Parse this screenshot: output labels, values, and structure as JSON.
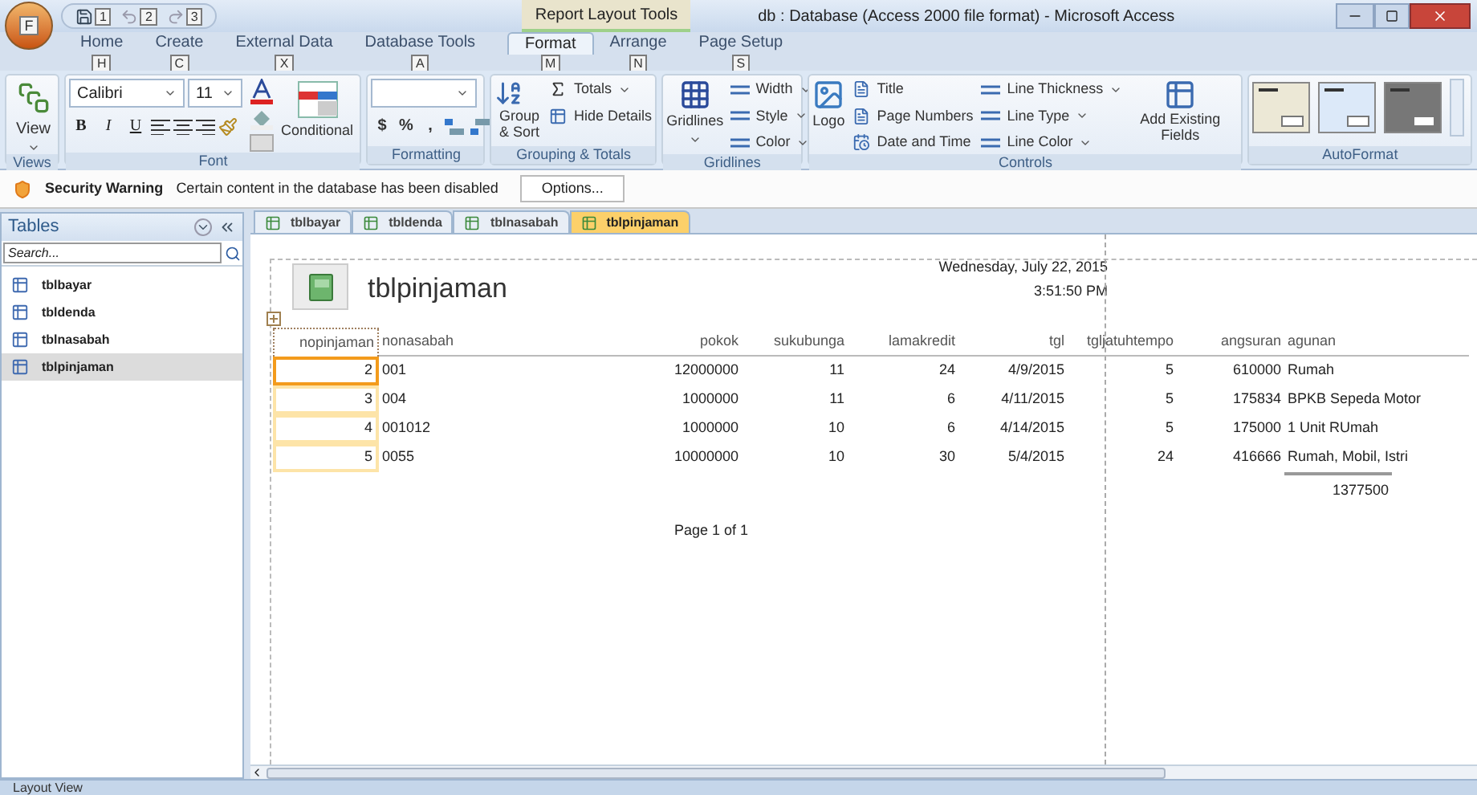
{
  "title_bar": {
    "quick_keytips": [
      "1",
      "2",
      "3"
    ],
    "context_label": "Report Layout Tools",
    "title": "db : Database (Access 2000 file format) - Microsoft Access",
    "office_keytip": "F"
  },
  "ribbon_tabs": [
    {
      "label": "Home",
      "keytip": "H",
      "selected": false
    },
    {
      "label": "Create",
      "keytip": "C",
      "selected": false
    },
    {
      "label": "External Data",
      "keytip": "X",
      "selected": false
    },
    {
      "label": "Database Tools",
      "keytip": "A",
      "selected": false
    },
    {
      "label": "Format",
      "keytip": "M",
      "selected": true
    },
    {
      "label": "Arrange",
      "keytip": "N",
      "selected": false
    },
    {
      "label": "Page Setup",
      "keytip": "S",
      "selected": false
    }
  ],
  "ribbon_groups": [
    {
      "kind": "views",
      "label": "Views",
      "button": "View"
    },
    {
      "kind": "font",
      "label": "Font",
      "font_name": "Calibri",
      "font_size": "11",
      "styles": [
        "B",
        "I",
        "U"
      ],
      "conditional": "Conditional"
    },
    {
      "kind": "formatting",
      "label": "Formatting",
      "symbols": [
        "$",
        "%",
        ","
      ]
    },
    {
      "kind": "grouping",
      "label": "Grouping & Totals",
      "group_sort": "Group & Sort",
      "totals": "Totals",
      "hide_details": "Hide Details"
    },
    {
      "kind": "gridlines",
      "label": "Gridlines",
      "gridlines": "Gridlines",
      "options": [
        "Width",
        "Style",
        "Color"
      ]
    },
    {
      "kind": "controls",
      "label": "Controls",
      "logo": "Logo",
      "inserts": [
        "Title",
        "Page Numbers",
        "Date and Time"
      ],
      "lines": [
        "Line Thickness",
        "Line Type",
        "Line Color"
      ],
      "add_fields": "Add Existing Fields"
    },
    {
      "kind": "autoformat",
      "label": "AutoFormat",
      "swatches": [
        {
          "color": "#ece8d6"
        },
        {
          "color": "#dce9f9"
        },
        {
          "color": "#777777"
        }
      ]
    }
  ],
  "security_bar": {
    "label": "Security Warning",
    "message": "Certain content in the database has been disabled",
    "button": "Options..."
  },
  "navigation_pane": {
    "header": "Tables",
    "search": {
      "placeholder": "Search..."
    },
    "items": [
      {
        "label": "tblbayar",
        "selected": false
      },
      {
        "label": "tbldenda",
        "selected": false
      },
      {
        "label": "tblnasabah",
        "selected": false
      },
      {
        "label": "tblpinjaman",
        "selected": true
      }
    ]
  },
  "document_tabs": [
    {
      "label": "tblbayar",
      "selected": false
    },
    {
      "label": "tbldenda",
      "selected": false
    },
    {
      "label": "tblnasabah",
      "selected": false
    },
    {
      "label": "tblpinjaman",
      "selected": true
    }
  ],
  "report": {
    "title": "tblpinjaman",
    "date": "Wednesday, July 22, 2015",
    "time": "3:51:50 PM",
    "columns": [
      {
        "label": "nopinjaman",
        "kind": "number"
      },
      {
        "label": "nonasabah",
        "kind": "text"
      },
      {
        "label": "pokok",
        "kind": "number"
      },
      {
        "label": "sukubunga",
        "kind": "number"
      },
      {
        "label": "lamakredit",
        "kind": "number"
      },
      {
        "label": "tgl",
        "kind": "number"
      },
      {
        "label": "tgljatuhtempo",
        "kind": "number"
      },
      {
        "label": "angsuran",
        "kind": "number"
      },
      {
        "label": "agunan",
        "kind": "text"
      }
    ],
    "rows": [
      {
        "selected": true,
        "cells": [
          "2",
          "001",
          "12000000",
          "11",
          "24",
          "4/9/2015",
          "5",
          "610000",
          "Rumah"
        ]
      },
      {
        "selected": false,
        "cells": [
          "3",
          "004",
          "1000000",
          "11",
          "6",
          "4/11/2015",
          "5",
          "175834",
          "BPKB Sepeda Motor"
        ]
      },
      {
        "selected": false,
        "cells": [
          "4",
          "001012",
          "1000000",
          "10",
          "6",
          "4/14/2015",
          "5",
          "175000",
          "1 Unit RUmah"
        ]
      },
      {
        "selected": false,
        "cells": [
          "5",
          "0055",
          "10000000",
          "10",
          "30",
          "5/4/2015",
          "24",
          "416666",
          "Rumah, Mobil, Istri"
        ]
      }
    ],
    "angsuran_total": "1377500",
    "page_footer": "Page 1 of 1"
  },
  "status_bar": {
    "text": "Layout View"
  }
}
